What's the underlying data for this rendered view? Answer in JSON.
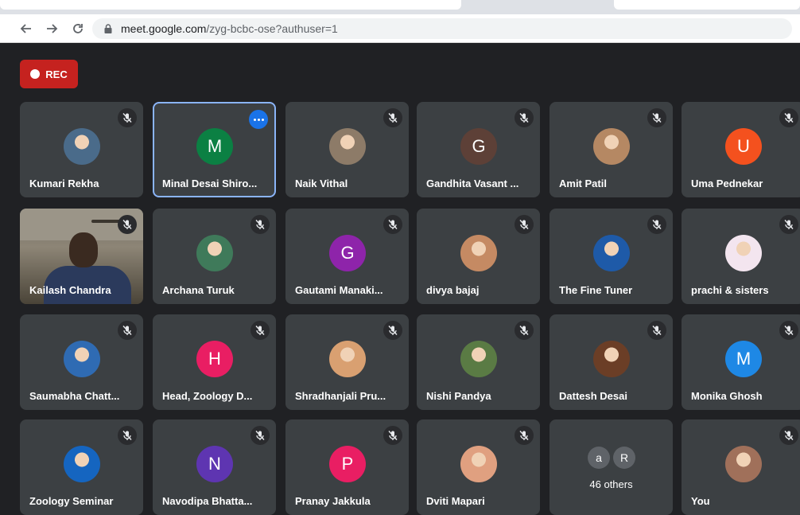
{
  "browser": {
    "url_host": "meet.google.com",
    "url_path": "/zyg-bcbc-ose?authuser=1"
  },
  "meet": {
    "rec_label": "REC",
    "colors": {
      "background": "#202124",
      "tile": "#3c4043",
      "rec": "#c5221f",
      "selected_border": "#8ab4f8",
      "menu_button": "#1a73e8"
    },
    "tiles": [
      {
        "name": "Kumari Rekha",
        "type": "photo",
        "color": "#4a6b8a"
      },
      {
        "name": "Minal Desai Shiro...",
        "type": "letter",
        "letter": "M",
        "color": "#0b8043",
        "selected": true
      },
      {
        "name": "Naik Vithal",
        "type": "photo",
        "color": "#8d7b68"
      },
      {
        "name": "Gandhita Vasant ...",
        "type": "letter",
        "letter": "G",
        "color": "#5d4037"
      },
      {
        "name": "Amit Patil",
        "type": "photo",
        "color": "#b58863"
      },
      {
        "name": "Uma Pednekar",
        "type": "letter",
        "letter": "U",
        "color": "#f4511e"
      },
      {
        "name": "Kailash Chandra",
        "type": "video"
      },
      {
        "name": "Archana Turuk",
        "type": "photo",
        "color": "#3f7a5a"
      },
      {
        "name": "Gautami Manaki...",
        "type": "letter",
        "letter": "G",
        "color": "#8e24aa"
      },
      {
        "name": "divya bajaj",
        "type": "photo",
        "color": "#c58a63"
      },
      {
        "name": "The Fine Tuner",
        "type": "photo",
        "color": "#1e5aa8"
      },
      {
        "name": "prachi & sisters",
        "type": "photo",
        "color": "#f3e5ef"
      },
      {
        "name": "Saumabha Chatt...",
        "type": "photo",
        "color": "#2f6bb3"
      },
      {
        "name": "Head, Zoology D...",
        "type": "letter",
        "letter": "H",
        "color": "#e91e63"
      },
      {
        "name": "Shradhanjali Pru...",
        "type": "photo",
        "color": "#d9a071"
      },
      {
        "name": "Nishi Pandya",
        "type": "photo",
        "color": "#5a7b44"
      },
      {
        "name": "Dattesh Desai",
        "type": "photo",
        "color": "#6b3e26"
      },
      {
        "name": "Monika Ghosh",
        "type": "letter",
        "letter": "M",
        "color": "#1e88e5"
      },
      {
        "name": "Zoology Seminar",
        "type": "photo",
        "color": "#1565c0"
      },
      {
        "name": "Navodipa Bhatta...",
        "type": "letter",
        "letter": "N",
        "color": "#5e35b1"
      },
      {
        "name": "Pranay Jakkula",
        "type": "letter",
        "letter": "P",
        "color": "#e91e63"
      },
      {
        "name": "Dviti Mapari",
        "type": "photo",
        "color": "#e0a080"
      },
      {
        "name": "46 others",
        "type": "others",
        "mini": [
          "a",
          "R"
        ]
      },
      {
        "name": "You",
        "type": "photo",
        "color": "#a0705a"
      }
    ]
  }
}
